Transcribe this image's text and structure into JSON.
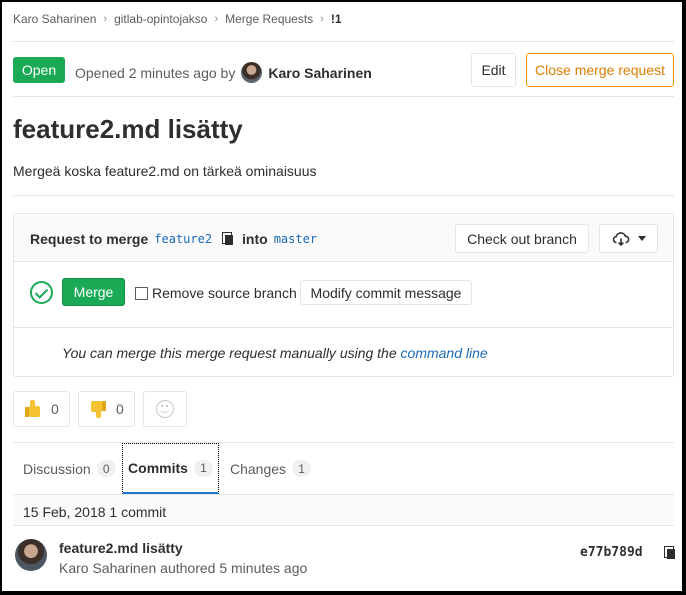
{
  "breadcrumb": {
    "items": [
      "Karo Saharinen",
      "gitlab-opintojakso",
      "Merge Requests",
      "!1"
    ]
  },
  "header": {
    "status": "Open",
    "opened_text": "Opened 2 minutes ago by",
    "author": "Karo Saharinen",
    "edit_label": "Edit",
    "close_label": "Close merge request"
  },
  "merge_request": {
    "title": "feature2.md lisätty",
    "description": "Mergeä koska feature2.md on tärkeä ominaisuus"
  },
  "widget": {
    "request_prefix": "Request to merge",
    "source_branch": "feature2",
    "into_label": "into",
    "target_branch": "master",
    "checkout_label": "Check out branch",
    "download_icon": "cloud-download-icon",
    "merge_label": "Merge",
    "remove_source_label": "Remove source branch",
    "remove_source_checked": false,
    "modify_commit_label": "Modify commit message",
    "manual_text": "You can merge this merge request manually using the",
    "manual_link": "command line"
  },
  "awards": {
    "thumbs_up_count": "0",
    "thumbs_down_count": "0"
  },
  "tabs": [
    {
      "label": "Discussion",
      "count": "0"
    },
    {
      "label": "Commits",
      "count": "1",
      "active": true
    },
    {
      "label": "Changes",
      "count": "1"
    }
  ],
  "commits": {
    "day_header": "15 Feb, 2018 1 commit",
    "items": [
      {
        "title": "feature2.md lisätty",
        "meta": "Karo Saharinen authored 5 minutes ago",
        "sha": "e77b789d"
      }
    ]
  },
  "colors": {
    "accent_green": "#1aaa55",
    "close_orange": "#fc9403",
    "link_blue": "#1b69b6",
    "active_tab_blue": "#1f78d1"
  }
}
